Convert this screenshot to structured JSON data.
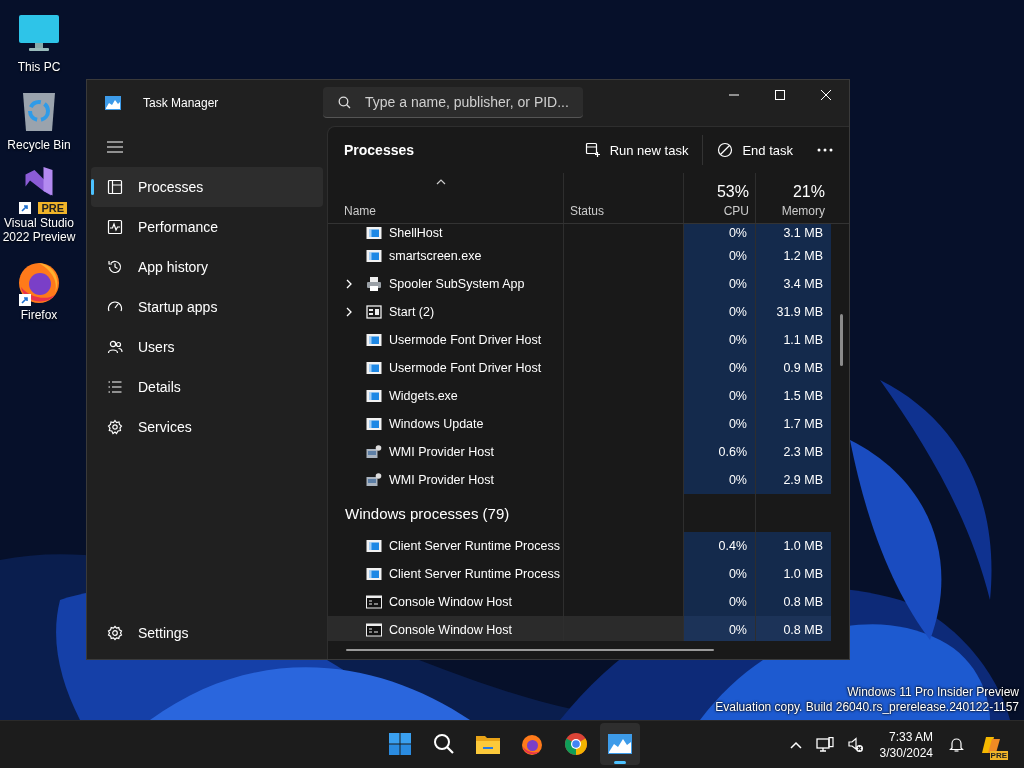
{
  "desktop_icons": [
    {
      "kind": "pc",
      "label": "This PC",
      "shortcut": false
    },
    {
      "kind": "recycle",
      "label": "Recycle Bin",
      "shortcut": false
    },
    {
      "kind": "vs",
      "label": "Visual Studio 2022 Preview",
      "badge": "PRE",
      "shortcut": true
    },
    {
      "kind": "firefox",
      "label": "Firefox",
      "shortcut": true
    }
  ],
  "window": {
    "title": "Task Manager",
    "search": {
      "placeholder": "Type a name, publisher, or PID..."
    }
  },
  "sidebar": {
    "items": [
      {
        "kind": "processes",
        "label": "Processes",
        "selected": true
      },
      {
        "kind": "performance",
        "label": "Performance",
        "selected": false
      },
      {
        "kind": "history",
        "label": "App history",
        "selected": false
      },
      {
        "kind": "startup",
        "label": "Startup apps",
        "selected": false
      },
      {
        "kind": "users",
        "label": "Users",
        "selected": false
      },
      {
        "kind": "details",
        "label": "Details",
        "selected": false
      },
      {
        "kind": "services",
        "label": "Services",
        "selected": false
      }
    ],
    "settings": {
      "label": "Settings"
    }
  },
  "page": {
    "title": "Processes",
    "actions": [
      {
        "kind": "run",
        "label": "Run new task"
      },
      {
        "kind": "end",
        "label": "End task"
      }
    ]
  },
  "table": {
    "columns": [
      {
        "label": "Name",
        "sorted": true
      },
      {
        "label": "Status",
        "sorted": false
      },
      {
        "label": "CPU",
        "total": "53%",
        "sorted": false
      },
      {
        "label": "Memory",
        "total": "21%",
        "sorted": false
      }
    ],
    "rows": [
      {
        "kind": "app",
        "name": "ShellHost",
        "cpu": "0%",
        "memory": "3.1 MB",
        "selected": false
      },
      {
        "kind": "app",
        "name": "smartscreen.exe",
        "cpu": "0%",
        "memory": "1.2 MB",
        "selected": false
      },
      {
        "kind": "printer",
        "name": "Spooler SubSystem App",
        "cpu": "0%",
        "memory": "3.4 MB",
        "selected": false,
        "expanded": false
      },
      {
        "kind": "start",
        "name": "Start (2)",
        "cpu": "0%",
        "memory": "31.9 MB",
        "selected": false,
        "expanded": false
      },
      {
        "kind": "app",
        "name": "Usermode Font Driver Host",
        "cpu": "0%",
        "memory": "1.1 MB",
        "selected": false
      },
      {
        "kind": "app",
        "name": "Usermode Font Driver Host",
        "cpu": "0%",
        "memory": "0.9 MB",
        "selected": false
      },
      {
        "kind": "app",
        "name": "Widgets.exe",
        "cpu": "0%",
        "memory": "1.5 MB",
        "selected": false
      },
      {
        "kind": "app",
        "name": "Windows Update",
        "cpu": "0%",
        "memory": "1.7 MB",
        "selected": false
      },
      {
        "kind": "wmi",
        "name": "WMI Provider Host",
        "cpu": "0.6%",
        "memory": "2.3 MB",
        "selected": false
      },
      {
        "kind": "wmi",
        "name": "WMI Provider Host",
        "cpu": "0%",
        "memory": "2.9 MB",
        "selected": false
      },
      {
        "kind": "group",
        "name": "Windows processes (79)",
        "selected": false
      },
      {
        "kind": "app",
        "name": "Client Server Runtime Process",
        "cpu": "0.4%",
        "memory": "1.0 MB",
        "selected": false
      },
      {
        "kind": "app",
        "name": "Client Server Runtime Process",
        "cpu": "0%",
        "memory": "1.0 MB",
        "selected": false
      },
      {
        "kind": "console",
        "name": "Console Window Host",
        "cpu": "0%",
        "memory": "0.8 MB",
        "selected": false
      },
      {
        "kind": "console",
        "name": "Console Window Host",
        "cpu": "0%",
        "memory": "0.8 MB",
        "selected": true
      }
    ]
  },
  "desktop_notice": [
    "Windows 11 Pro Insider Preview",
    "Evaluation copy. Build 26040.rs_prerelease.240122-1157"
  ],
  "taskbar": {
    "apps": [
      {
        "kind": "start",
        "active": false
      },
      {
        "kind": "search",
        "active": false
      },
      {
        "kind": "explorer",
        "active": false
      },
      {
        "kind": "firefox",
        "active": false
      },
      {
        "kind": "chrome",
        "active": false
      },
      {
        "kind": "taskmgr",
        "active": true
      }
    ],
    "clock": {
      "time": "7:33 AM",
      "date": "3/30/2024"
    },
    "copilot_badge": "PRE"
  }
}
